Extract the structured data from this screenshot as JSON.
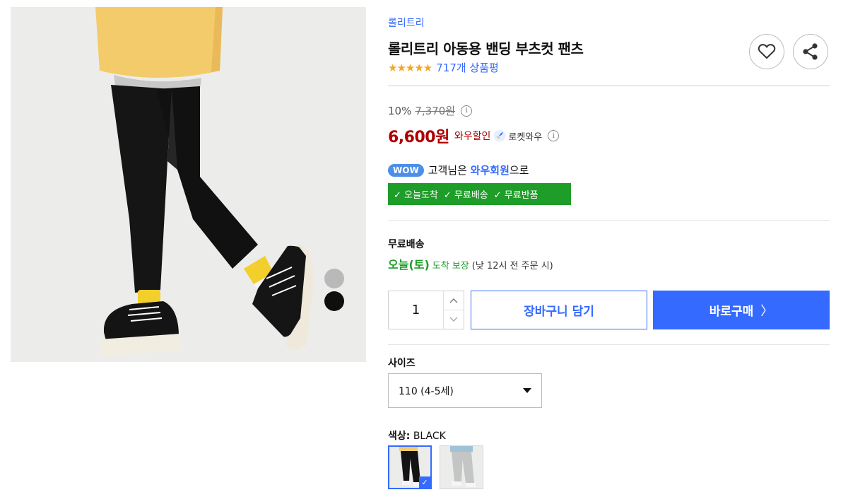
{
  "product": {
    "brand": "롤리트리",
    "title": "롤리트리 아동용 밴딩 부츠컷 팬츠",
    "stars": "★★★★★",
    "review_count": "717개 상품평"
  },
  "price": {
    "discount_rate": "10%",
    "original_price": "7,370원",
    "sale_price": "6,600원",
    "wow_discount_label": "와우할인",
    "rocket_label": "로켓와우",
    "info_icon": "i"
  },
  "membership": {
    "badge": "WOW",
    "prefix": "고객님은",
    "highlight": "와우회원",
    "suffix": "으로",
    "benefits": [
      "✓ 오늘도착",
      "✓ 무료배송",
      "✓ 무료반품"
    ]
  },
  "shipping": {
    "label": "무료배송",
    "day": "오늘(토)",
    "guarantee": "도착 보장",
    "note": "(낮 12시 전 주문 시)"
  },
  "actions": {
    "quantity": "1",
    "cart_label": "장바구니 담기",
    "buy_label": "바로구매",
    "buy_chevron": "〉"
  },
  "options": {
    "size_label": "사이즈",
    "size_selected": "110 (4-5세)",
    "color_label": "색상:",
    "color_selected": "BLACK",
    "check_mark": "✓"
  },
  "icons": {
    "wishlist": "heart-icon",
    "share": "share-icon",
    "rocket": "rocket-icon"
  },
  "colors": {
    "accent_blue": "#346aff",
    "price_red": "#ae0000",
    "benefit_green": "#1f9d29",
    "star_yellow": "#f5a623"
  }
}
